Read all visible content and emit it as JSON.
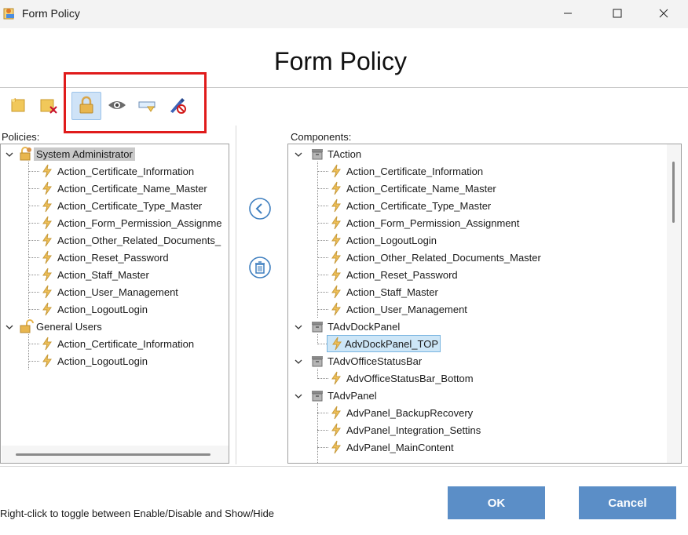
{
  "window": {
    "title": "Form Policy",
    "app_icon": "form-policy-app-icon",
    "controls": [
      "minimize-icon",
      "maximize-icon",
      "close-icon"
    ]
  },
  "header": {
    "title": "Form Policy"
  },
  "toolbar": {
    "buttons": [
      {
        "name": "new-policy-icon",
        "active": false
      },
      {
        "name": "delete-policy-icon",
        "active": false
      },
      {
        "name": "lock-icon",
        "active": true
      },
      {
        "name": "eye-icon",
        "active": false
      },
      {
        "name": "edit-field-icon",
        "active": false
      },
      {
        "name": "disable-edit-icon",
        "active": false
      }
    ],
    "highlight_color": "#e01b1b"
  },
  "policies": {
    "label": "Policies:",
    "groups": [
      {
        "name": "System Administrator",
        "items": [
          "Action_Certificate_Information",
          "Action_Certificate_Name_Master",
          "Action_Certificate_Type_Master",
          "Action_Form_Permission_Assignme",
          "Action_Other_Related_Documents_",
          "Action_Reset_Password",
          "Action_Staff_Master",
          "Action_User_Management",
          "Action_LogoutLogin"
        ]
      },
      {
        "name": "General Users",
        "items": [
          "Action_Certificate_Information",
          "Action_LogoutLogin"
        ]
      }
    ]
  },
  "components": {
    "label": "Components:",
    "groups": [
      {
        "name": "TAction",
        "items": [
          "Action_Certificate_Information",
          "Action_Certificate_Name_Master",
          "Action_Certificate_Type_Master",
          "Action_Form_Permission_Assignment",
          "Action_LogoutLogin",
          "Action_Other_Related_Documents_Master",
          "Action_Reset_Password",
          "Action_Staff_Master",
          "Action_User_Management"
        ]
      },
      {
        "name": "TAdvDockPanel",
        "items": [
          "AdvDockPanel_TOP"
        ]
      },
      {
        "name": "TAdvOfficeStatusBar",
        "items": [
          "AdvOfficeStatusBar_Bottom"
        ]
      },
      {
        "name": "TAdvPanel",
        "items": [
          "AdvPanel_BackupRecovery",
          "AdvPanel_Integration_Settins",
          "AdvPanel_MainContent"
        ]
      }
    ]
  },
  "middle_buttons": [
    "back-arrow-icon",
    "trash-icon"
  ],
  "footer": {
    "hint": "Right-click to toggle between Enable/Disable and Show/Hide",
    "ok_label": "OK",
    "cancel_label": "Cancel",
    "button_color": "#5b8ec7"
  }
}
